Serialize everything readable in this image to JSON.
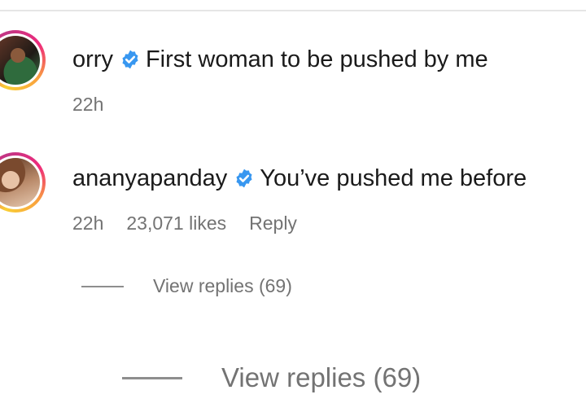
{
  "comments": [
    {
      "username": "orry",
      "verified": true,
      "text": "First woman to be pushed by me",
      "time": "22h",
      "avatar_icon": "avatar-photo"
    },
    {
      "username": "ananyapanday",
      "verified": true,
      "text": "You’ve pushed me before",
      "time": "22h",
      "likes": "23,071 likes",
      "reply_label": "Reply",
      "avatar_icon": "avatar-photo",
      "view_replies": "View replies (69)"
    }
  ],
  "zoomed_view_replies": "View replies (69)",
  "colors": {
    "verified_badge": "#3897f0",
    "meta_text": "#737373",
    "story_ring": [
      "#f9ce34",
      "#ee2a7b",
      "#c13584"
    ]
  }
}
